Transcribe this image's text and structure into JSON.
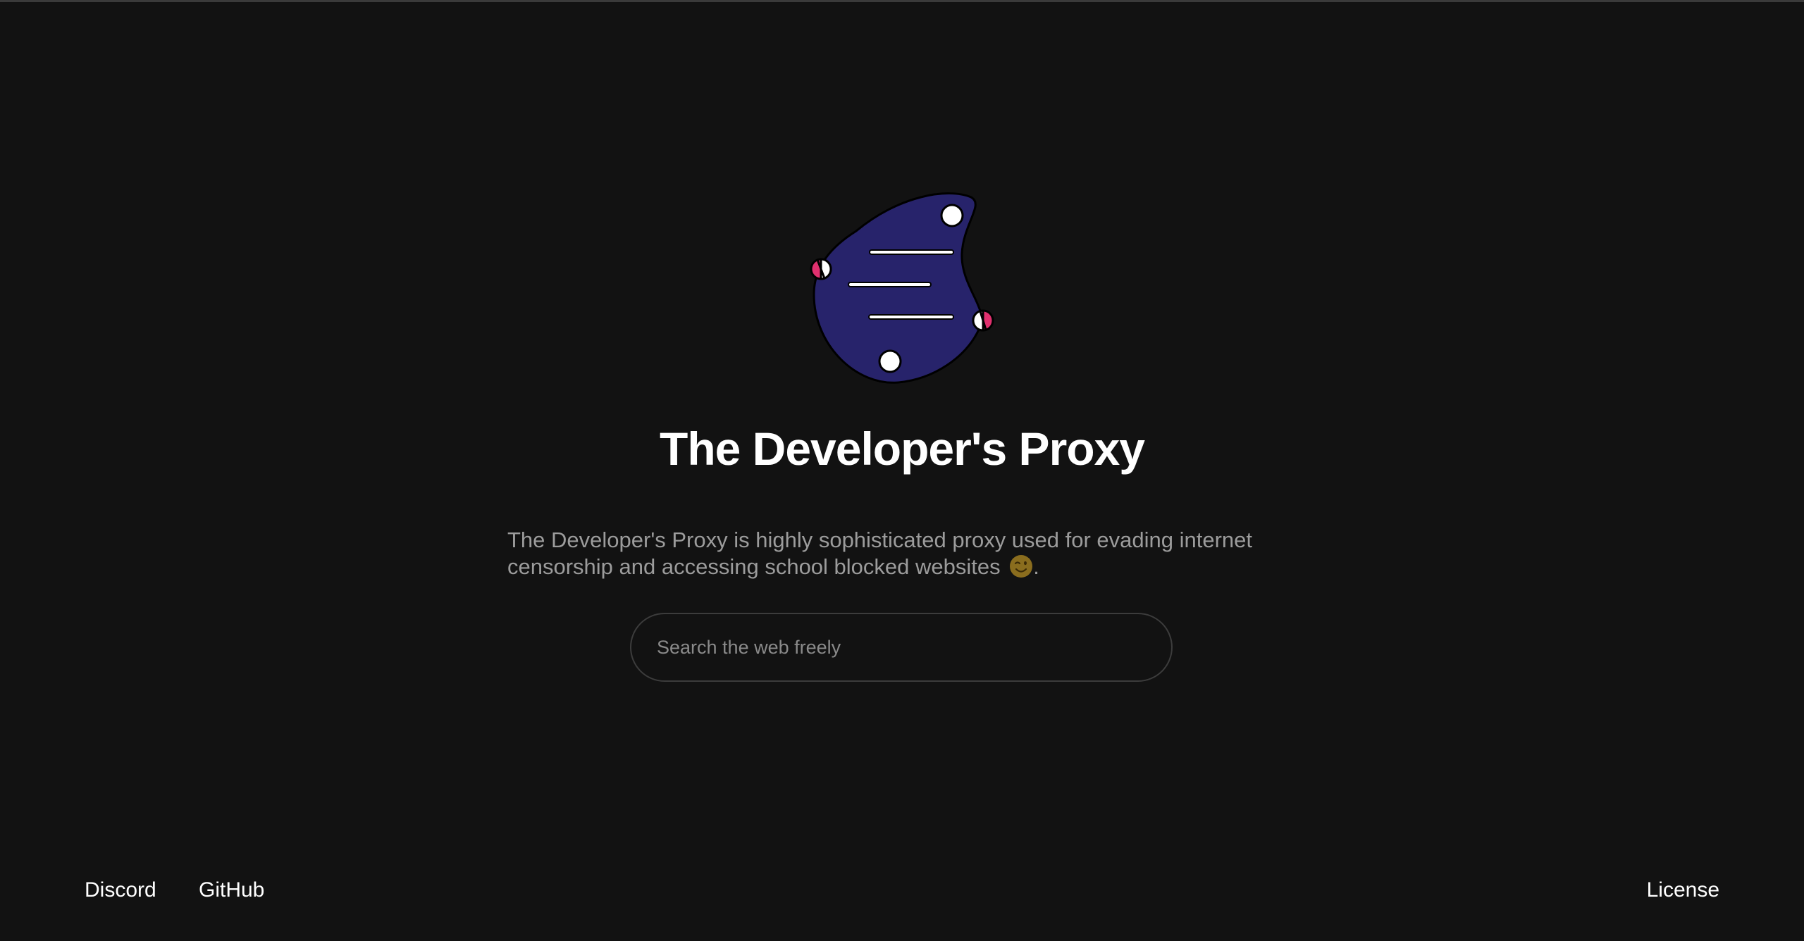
{
  "header": {
    "title": "The Developer's Proxy",
    "description": "The Developer's Proxy is highly sophisticated proxy used for evading internet censorship and accessing school blocked websites",
    "description_end": "."
  },
  "logo": {
    "icon": "blob-logo-icon",
    "fill_color": "#27236b",
    "accent_color": "#e0306e"
  },
  "search": {
    "placeholder": "Search the web freely",
    "value": ""
  },
  "footer": {
    "links_left": [
      "Discord",
      "GitHub"
    ],
    "link_right": "License"
  },
  "icons": {
    "emoji": "winking-face-icon"
  }
}
